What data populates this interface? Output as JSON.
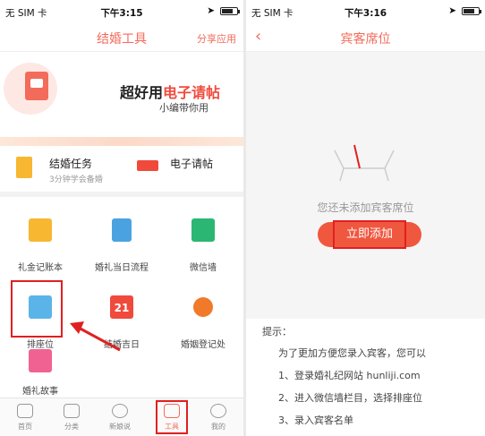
{
  "left": {
    "status": {
      "carrier": "无 SIM 卡",
      "time": "下午3:15"
    },
    "nav": {
      "title": "结婚工具",
      "share": "分享应用"
    },
    "banner": {
      "title_part1": "超好用",
      "title_part2": "电子请帖",
      "subtitle": "小编带你用"
    },
    "quick": [
      {
        "title": "结婚任务",
        "subtitle": "3分钟学会备婚"
      },
      {
        "title": "电子请帖"
      }
    ],
    "grid": [
      {
        "label": "礼金记账本",
        "color": "#f7b731"
      },
      {
        "label": "婚礼当日流程",
        "color": "#4aa3e0"
      },
      {
        "label": "微信墙",
        "color": "#2bb673"
      },
      {
        "label": "排座位",
        "color": "#5ab4e8"
      },
      {
        "label": "结婚吉日",
        "color": "#f04a3c"
      },
      {
        "label": "婚姻登记处",
        "color": "#f07a2a"
      },
      {
        "label": "婚礼故事",
        "color": "#f06292"
      }
    ],
    "calendar_num": "21",
    "tabs": [
      {
        "label": "首页"
      },
      {
        "label": "分类"
      },
      {
        "label": "新娘说"
      },
      {
        "label": "工具",
        "active": true
      },
      {
        "label": "我的"
      }
    ]
  },
  "right": {
    "status": {
      "carrier": "无 SIM 卡",
      "time": "下午3:16"
    },
    "nav": {
      "title": "宾客席位"
    },
    "empty_text": "您还未添加宾客席位",
    "add_button": "立即添加",
    "tips_header": "提示：",
    "tips": [
      "为了更加方便您录入宾客，您可以",
      "1、登录婚礼纪网站 hunliji.com",
      "2、进入微信墙栏目，选择排座位",
      "3、录入宾客名单"
    ]
  },
  "colors": {
    "accent": "#f36b5a",
    "highlight": "#e02020"
  }
}
